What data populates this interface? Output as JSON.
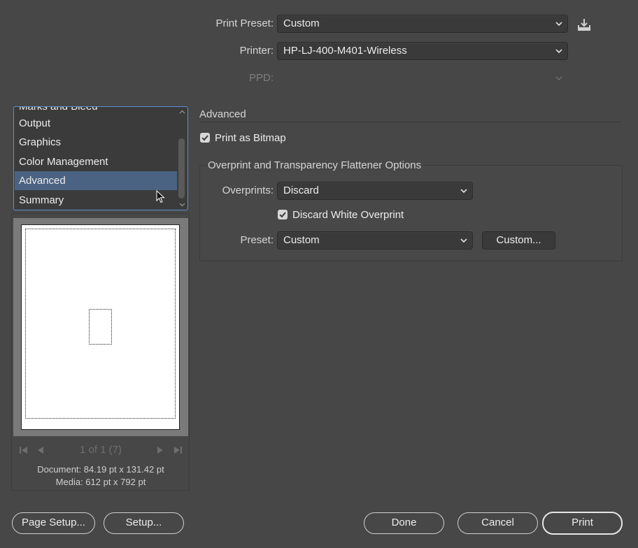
{
  "header": {
    "print_preset_label": "Print Preset:",
    "print_preset_value": "Custom",
    "printer_label": "Printer:",
    "printer_value": "HP-LJ-400-M401-Wireless",
    "ppd_label": "PPD:",
    "ppd_value": ""
  },
  "categories": {
    "partial_top": "Marks and Bleed",
    "items": [
      "Output",
      "Graphics",
      "Color Management",
      "Advanced",
      "Summary"
    ],
    "selected": "Advanced"
  },
  "preview": {
    "page_indicator": "1 of 1 (7)",
    "document_info": "Document: 84.19 pt x 131.42 pt",
    "media_info": "Media: 612 pt x 792 pt"
  },
  "advanced": {
    "section_title": "Advanced",
    "print_as_bitmap_label": "Print as Bitmap",
    "print_as_bitmap_checked": true,
    "group_title": "Overprint and Transparency Flattener Options",
    "overprints_label": "Overprints:",
    "overprints_value": "Discard",
    "discard_white_label": "Discard White Overprint",
    "discard_white_checked": true,
    "preset_label": "Preset:",
    "preset_value": "Custom",
    "custom_button": "Custom..."
  },
  "footer": {
    "page_setup": "Page Setup...",
    "setup": "Setup...",
    "done": "Done",
    "cancel": "Cancel",
    "print": "Print"
  },
  "colors": {
    "background": "#474747",
    "selection": "#4b6382",
    "list_border": "#5f8fc9"
  }
}
